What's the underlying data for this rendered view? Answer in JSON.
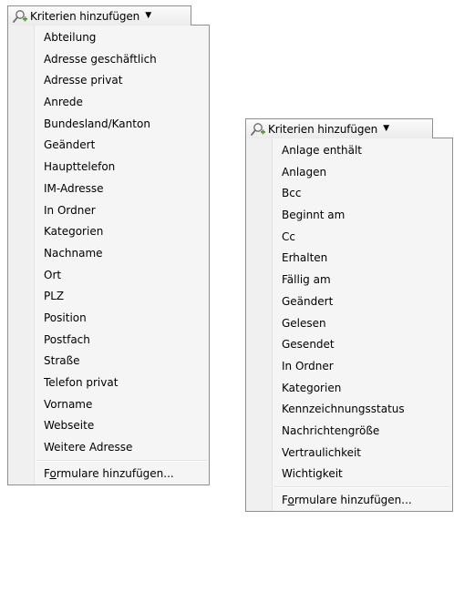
{
  "left_menu": {
    "button_label": "Kriterien hinzufügen",
    "items": [
      "Abteilung",
      "Adresse geschäftlich",
      "Adresse privat",
      "Anrede",
      "Bundesland/Kanton",
      "Geändert",
      "Haupttelefon",
      "IM-Adresse",
      "In Ordner",
      "Kategorien",
      "Nachname",
      "Ort",
      "PLZ",
      "Position",
      "Postfach",
      "Straße",
      "Telefon privat",
      "Vorname",
      "Webseite",
      "Weitere Adresse"
    ],
    "footer": {
      "before": "F",
      "mnemonic": "o",
      "after": "rmulare hinzufügen..."
    }
  },
  "right_menu": {
    "button_label": "Kriterien hinzufügen",
    "items": [
      "Anlage enthält",
      "Anlagen",
      "Bcc",
      "Beginnt am",
      "Cc",
      "Erhalten",
      "Fällig am",
      "Geändert",
      "Gelesen",
      "Gesendet",
      "In Ordner",
      "Kategorien",
      "Kennzeichnungsstatus",
      "Nachrichtengröße",
      "Vertraulichkeit",
      "Wichtigkeit"
    ],
    "footer": {
      "before": "F",
      "mnemonic": "o",
      "after": "rmulare hinzufügen..."
    }
  },
  "icons": {
    "button_icon": "search-add-icon",
    "dropdown_icon": "chevron-down-icon"
  },
  "colors": {
    "border": "#8f8f8f",
    "menu_background": "#f5f5f5",
    "gutter": "#f0f0f0"
  }
}
